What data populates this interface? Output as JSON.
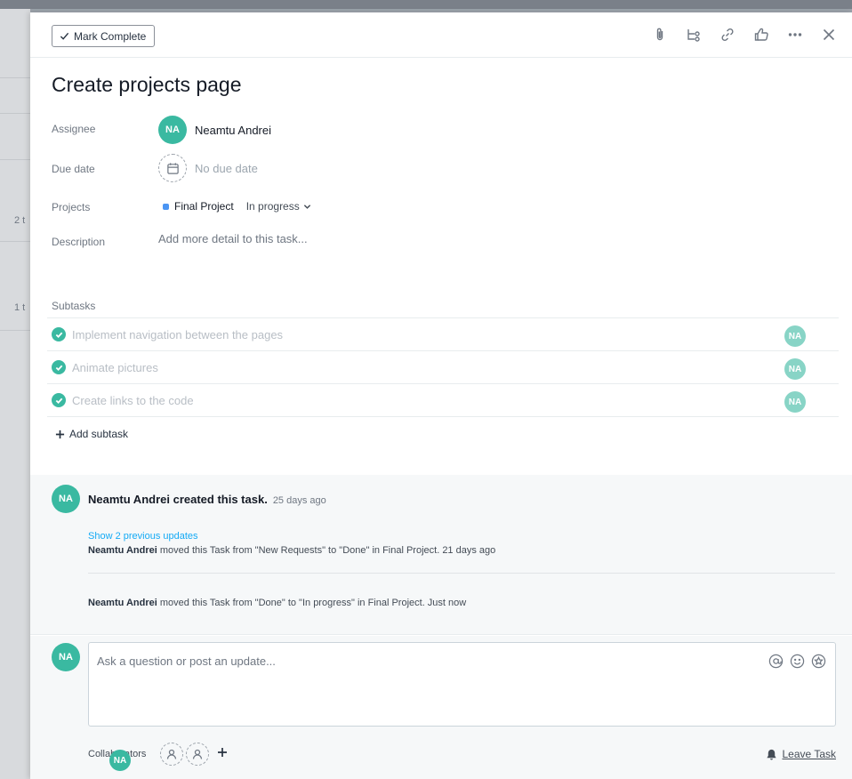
{
  "backdrop": {
    "fragments": [
      "2 t",
      "1 t"
    ]
  },
  "header": {
    "mark_complete_label": "Mark Complete",
    "tools": [
      "paperclip-icon",
      "subtask-icon",
      "link-icon",
      "thumbs-up-icon",
      "more-icon",
      "close-icon"
    ]
  },
  "task": {
    "title": "Create projects page",
    "assignee_label": "Assignee",
    "assignee_initials": "NA",
    "assignee_name": "Neamtu Andrei",
    "due_label": "Due date",
    "due_value": "No due date",
    "projects_label": "Projects",
    "project_name": "Final Project",
    "project_status": "In progress",
    "description_label": "Description",
    "description_placeholder": "Add more detail to this task..."
  },
  "subtasks": {
    "label": "Subtasks",
    "items": [
      {
        "text": "Implement navigation between the pages",
        "assignee": "NA",
        "completed": true
      },
      {
        "text": "Animate pictures",
        "assignee": "NA",
        "completed": true
      },
      {
        "text": "Create links to the code",
        "assignee": "NA",
        "completed": true
      }
    ],
    "add_label": "Add subtask"
  },
  "activity": {
    "avatar": "NA",
    "creator_line": "Neamtu Andrei created this task.",
    "creator_time": "25 days ago",
    "show_previous": "Show 2 previous updates",
    "stories": [
      {
        "actor": "Neamtu Andrei",
        "text": " moved this Task from \"New Requests\" to \"Done\" in Final Project.  21 days ago"
      },
      {
        "actor": "Neamtu Andrei",
        "text": " moved this Task from \"Done\" to \"In progress\" in Final Project.  Just now"
      }
    ]
  },
  "composer": {
    "avatar": "NA",
    "placeholder": "Ask a question or post an update...",
    "collaborators_label": "Collaborators",
    "collaborator_avatar": "NA",
    "leave_label": "Leave Task"
  },
  "colors": {
    "avatar": "#3ab9a1",
    "project_dot": "#4b95f3",
    "link": "#14aaf5"
  }
}
